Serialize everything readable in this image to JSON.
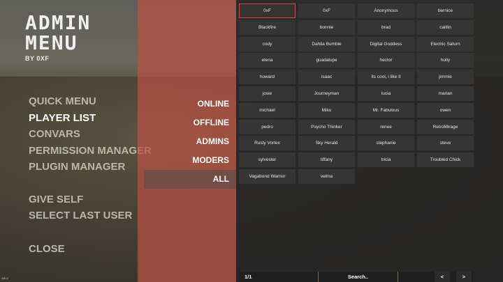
{
  "logo": {
    "line1": "ADMIN",
    "line2": "MENU",
    "by": "BY 0XF"
  },
  "menu": {
    "items": [
      {
        "label": "QUICK MENU"
      },
      {
        "label": "PLAYER LIST"
      },
      {
        "label": "CONVARS"
      },
      {
        "label": "PERMISSION MANAGER"
      },
      {
        "label": "PLUGIN MANAGER"
      }
    ],
    "give_self": "GIVE SELF",
    "select_last_user": "SELECT LAST USER",
    "close": "CLOSE",
    "active": "PLAYER LIST"
  },
  "filters": [
    {
      "label": "ONLINE"
    },
    {
      "label": "OFFLINE"
    },
    {
      "label": "ADMINS"
    },
    {
      "label": "MODERS"
    },
    {
      "label": "ALL"
    }
  ],
  "players": [
    "0xF",
    "0xF",
    "Anonymous",
    "bernice",
    "Blackfire",
    "bonnie",
    "brad",
    "caitlin",
    "cody",
    "Dahlia Bumble",
    "Digital Goddess",
    "Electric Saturn",
    "elena",
    "guadalupe",
    "hector",
    "holly",
    "howard",
    "isaac",
    "its cool, i like it",
    "jimmie",
    "josie",
    "Journeyman",
    "lucia",
    "marian",
    "michael",
    "Miku",
    "Mr. Fabulous",
    "owen",
    "pedro",
    "Psycho Thinker",
    "renee",
    "RetroMirage",
    "Rusty Vortex",
    "Sky Herald",
    "stephanie",
    "steve",
    "sylvester",
    "tiffany",
    "tricia",
    "Troubled Chick",
    "Vagabond Warrior",
    "velma"
  ],
  "pagination": {
    "page": "1/1",
    "search": "Search..",
    "prev": "<",
    "next": ">"
  },
  "corner_text": "ABLE"
}
